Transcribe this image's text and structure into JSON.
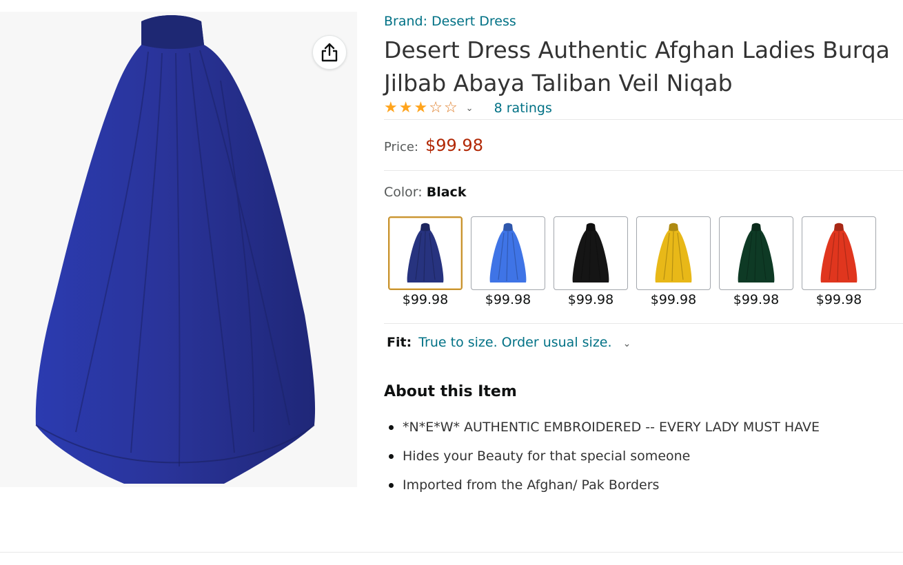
{
  "product": {
    "brand_link": "Brand: Desert Dress",
    "title": "Desert Dress Authentic Afghan Ladies Burqa Jilbab Abaya Taliban Veil Niqab",
    "main_image": {
      "subject": "navy blue full-length burqa",
      "color": "#2a349a"
    },
    "share_icon": "share-icon"
  },
  "rating": {
    "stars_filled": 3,
    "stars_total": 5,
    "star_color": "#ffa41c",
    "star_glyph_filled": "★",
    "star_glyph_empty": "☆",
    "chevron": "⌄",
    "count_link": "8 ratings"
  },
  "price": {
    "label": "Price:",
    "value": "$99.98",
    "color": "#b12704"
  },
  "color_selector": {
    "label": "Color:",
    "selected": "Black",
    "swatches": [
      {
        "color": "#27337f",
        "price": "$99.98",
        "selected": true
      },
      {
        "color": "#3f74e6",
        "price": "$99.98",
        "selected": false
      },
      {
        "color": "#151515",
        "price": "$99.98",
        "selected": false
      },
      {
        "color": "#e8b818",
        "price": "$99.98",
        "selected": false
      },
      {
        "color": "#0e3a25",
        "price": "$99.98",
        "selected": false
      },
      {
        "color": "#e0361e",
        "price": "$99.98",
        "selected": false
      }
    ]
  },
  "fit": {
    "label": "Fit:",
    "text": "True to size. Order usual size.",
    "chevron": "⌄"
  },
  "about": {
    "title": "About this Item",
    "bullets": [
      "*N*E*W* AUTHENTIC EMBROIDERED -- EVERY LADY MUST HAVE",
      "Hides your Beauty for that special someone",
      "Imported from the Afghan/ Pak Borders"
    ]
  },
  "colors": {
    "link": "#007185",
    "text": "#0f1111",
    "muted": "#565959",
    "selected_border": "#c7932f"
  }
}
